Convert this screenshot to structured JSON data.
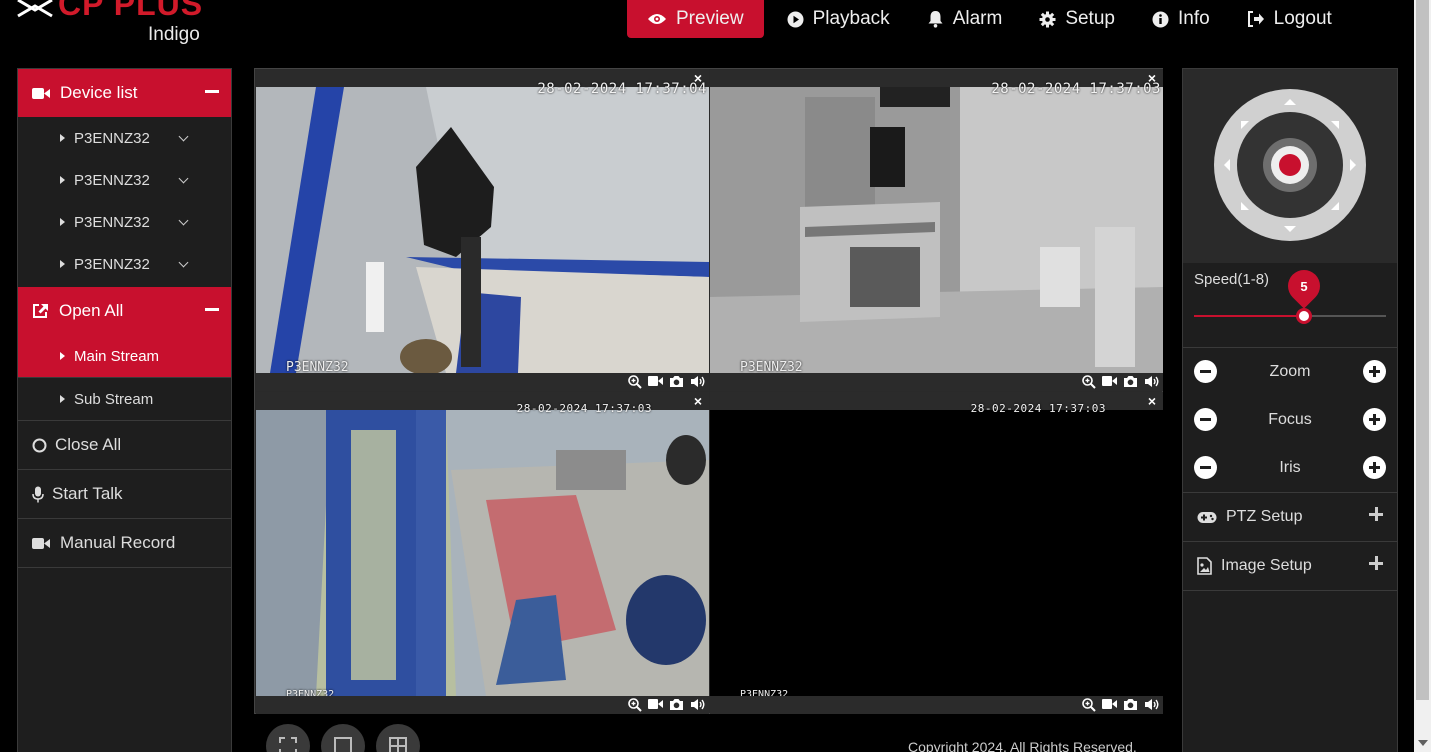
{
  "header": {
    "brand": "CP PLUS",
    "sub_brand": "Indigo",
    "nav": [
      {
        "label": "Preview",
        "icon": "eye-icon"
      },
      {
        "label": "Playback",
        "icon": "play-circle-icon"
      },
      {
        "label": "Alarm",
        "icon": "bell-icon"
      },
      {
        "label": "Setup",
        "icon": "gear-icon"
      },
      {
        "label": "Info",
        "icon": "info-icon"
      },
      {
        "label": "Logout",
        "icon": "logout-icon"
      }
    ]
  },
  "left_panel": {
    "device_list_label": "Device list",
    "devices": [
      "P3ENNZ32",
      "P3ENNZ32",
      "P3ENNZ32",
      "P3ENNZ32"
    ],
    "open_all_label": "Open All",
    "main_stream_label": "Main Stream",
    "sub_stream_label": "Sub Stream",
    "close_all_label": "Close All",
    "start_talk_label": "Start Talk",
    "manual_record_label": "Manual Record"
  },
  "video": {
    "cells": [
      {
        "timestamp": "28-02-2024 17:37:04",
        "camera": "P3ENNZ32"
      },
      {
        "timestamp": "28-02-2024 17:37:03",
        "camera": "P3ENNZ32"
      },
      {
        "timestamp": "28-02-2024 17:37:03",
        "camera": "P3ENNZ32"
      },
      {
        "timestamp": "28-02-2024 17:37:03",
        "camera": "P3ENNZ32"
      }
    ],
    "close_glyph": "×",
    "copyright": "Copyright 2024. All Rights Reserved."
  },
  "right_panel": {
    "speed_label": "Speed(1-8)",
    "speed_value": "5",
    "speed_level": 5,
    "speed_max": 8,
    "zoom_label": "Zoom",
    "focus_label": "Focus",
    "iris_label": "Iris",
    "ptz_setup_label": "PTZ Setup",
    "image_setup_label": "Image Setup"
  },
  "colors": {
    "accent": "#c8102e",
    "panel": "#1e1e1e",
    "background": "#000000"
  }
}
